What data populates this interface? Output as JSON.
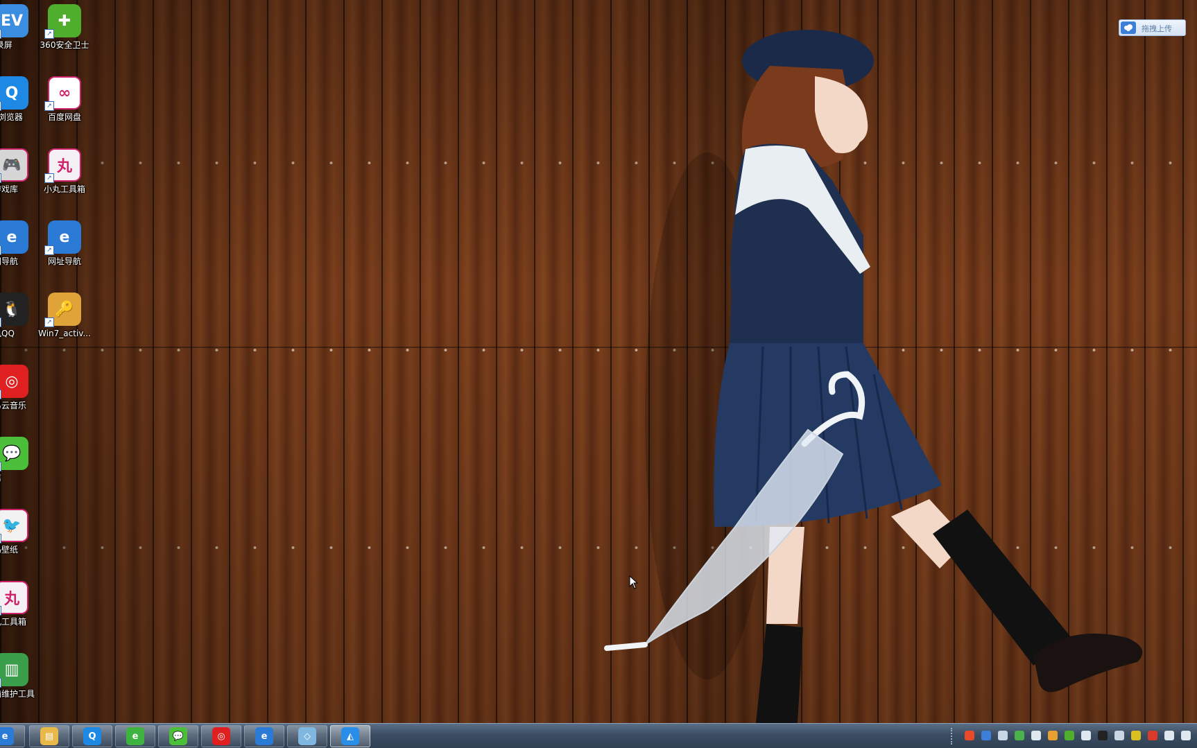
{
  "desktop": {
    "icons": [
      {
        "name": "ev-recorder-icon",
        "label": "EV录屏",
        "color": "#3b8de0",
        "glyph": "EV"
      },
      {
        "name": "qq-browser-icon",
        "label": "QQ浏览器",
        "color": "#1e88e5",
        "glyph": "Q"
      },
      {
        "name": "game-library-icon",
        "label": "纸游戏库",
        "color": "#d6d6d6",
        "glyph": "🎮"
      },
      {
        "name": "ie-navigation-icon",
        "label": "上网导航",
        "color": "#2b7bd6",
        "glyph": "e"
      },
      {
        "name": "tencent-qq-icon",
        "label": "腾讯QQ",
        "color": "#222222",
        "glyph": "🐧"
      },
      {
        "name": "netease-music-icon",
        "label": "网易云音乐",
        "color": "#e02020",
        "glyph": "◎"
      },
      {
        "name": "wechat-icon",
        "label": "微信",
        "color": "#4cbf3a",
        "glyph": "💬"
      },
      {
        "name": "bird-wallpaper-icon",
        "label": "小鸟壁纸",
        "color": "#f2f2f2",
        "glyph": "🐦"
      },
      {
        "name": "xiaowan-toolbox-icon",
        "label": "小丸工具箱",
        "color": "#f5f0f3",
        "glyph": "丸"
      },
      {
        "name": "computer-repair-tool-icon",
        "label": "电脑维护工具",
        "color": "#3b9e4a",
        "glyph": "▥"
      },
      {
        "name": "360-security-icon",
        "label": "360安全卫士",
        "color": "#4fae2c",
        "glyph": "✚"
      },
      {
        "name": "baidu-netdisk-icon",
        "label": "百度网盘",
        "color": "#ffffff",
        "glyph": "∞"
      },
      {
        "name": "xiaowan-toolbox-2-icon",
        "label": "小丸工具箱",
        "color": "#f5f0f3",
        "glyph": "丸"
      },
      {
        "name": "web-navigation-icon",
        "label": "网址导航",
        "color": "#2b7bd6",
        "glyph": "e"
      },
      {
        "name": "win7-activator-icon",
        "label": "Win7_activ...",
        "color": "#e0a33a",
        "glyph": "🔑"
      }
    ]
  },
  "upload_widget": {
    "label": "拖拽上传"
  },
  "taskbar": {
    "buttons": [
      {
        "name": "ie-taskbar-icon",
        "color": "#2b7bd6",
        "glyph": "e"
      },
      {
        "name": "file-explorer-taskbar-icon",
        "color": "#e8b84a",
        "glyph": "▤"
      },
      {
        "name": "qq-browser-taskbar-icon",
        "color": "#1e88e5",
        "glyph": "Q"
      },
      {
        "name": "360-browser-taskbar-icon",
        "color": "#3fb33f",
        "glyph": "e"
      },
      {
        "name": "wechat-taskbar-icon",
        "color": "#4cbf3a",
        "glyph": "💬"
      },
      {
        "name": "netease-music-taskbar-icon",
        "color": "#e02020",
        "glyph": "◎"
      },
      {
        "name": "internet-explorer-taskbar-icon",
        "color": "#2b7bd6",
        "glyph": "e"
      },
      {
        "name": "notes-taskbar-icon",
        "color": "#7fb7e0",
        "glyph": "◇"
      },
      {
        "name": "video-editor-taskbar-icon",
        "color": "#2a8ee8",
        "glyph": "◭"
      }
    ],
    "tray": [
      {
        "name": "sogou-input-icon",
        "color": "#e84a2a"
      },
      {
        "name": "help-icon",
        "color": "#3d7fd8"
      },
      {
        "name": "settings-small-icon",
        "color": "#c9d6e3"
      },
      {
        "name": "wifi-icon",
        "color": "#4bb24b"
      },
      {
        "name": "show-hidden-icons-icon",
        "color": "#dfe7ef"
      },
      {
        "name": "color-app-icon",
        "color": "#e8a030"
      },
      {
        "name": "360-tray-icon",
        "color": "#4fae2c"
      },
      {
        "name": "notification-icon",
        "color": "#dfe7ef"
      },
      {
        "name": "qq-tray-icon",
        "color": "#222222"
      },
      {
        "name": "tray-app-icon",
        "color": "#c9d6e3"
      },
      {
        "name": "security-tray-icon",
        "color": "#d9c020"
      },
      {
        "name": "action-center-icon",
        "color": "#d93a2a"
      },
      {
        "name": "network-bars-icon",
        "color": "#dfe7ef"
      },
      {
        "name": "volume-icon",
        "color": "#dfe7ef"
      }
    ]
  }
}
